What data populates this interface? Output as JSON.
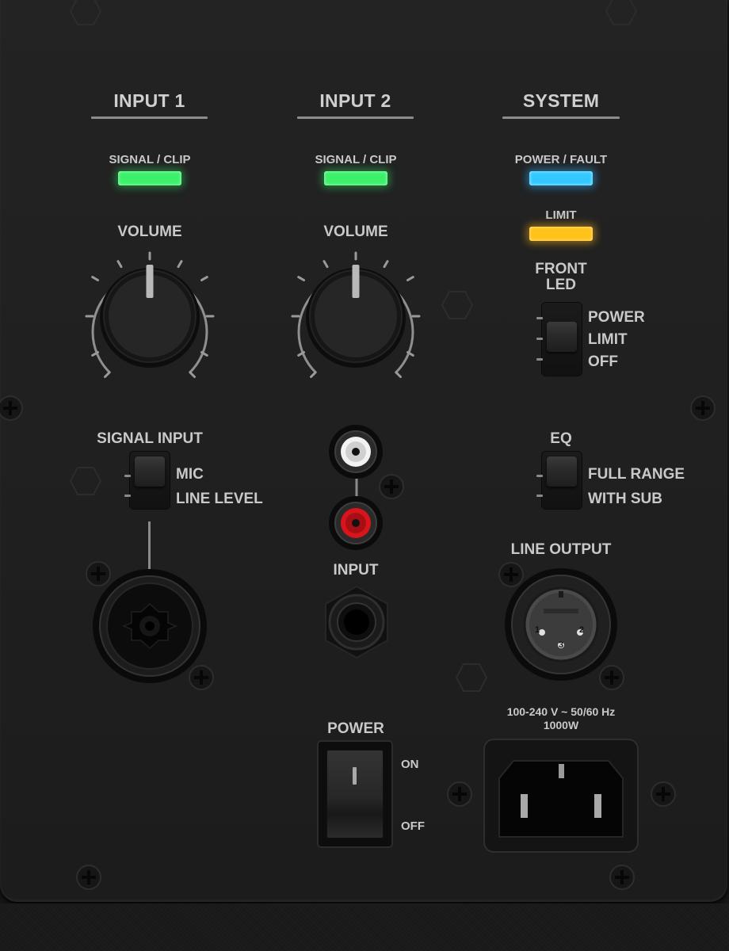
{
  "sections": {
    "input1": "INPUT 1",
    "input2": "INPUT 2",
    "system": "SYSTEM"
  },
  "indicators": {
    "signal_clip": "SIGNAL / CLIP",
    "power_fault": "POWER / FAULT",
    "limit": "LIMIT"
  },
  "volume_label": "VOLUME",
  "front_led": {
    "title_line1": "FRONT",
    "title_line2": "LED",
    "options": [
      "POWER",
      "LIMIT",
      "OFF"
    ]
  },
  "signal_input": {
    "title": "SIGNAL INPUT",
    "options": [
      "MIC",
      "LINE LEVEL"
    ]
  },
  "eq": {
    "title": "EQ",
    "options": [
      "FULL RANGE",
      "WITH SUB"
    ]
  },
  "input_jack_label": "INPUT",
  "line_output_label": "LINE OUTPUT",
  "xlr_pins": [
    "1",
    "3",
    "2"
  ],
  "power": {
    "title": "POWER",
    "on": "ON",
    "off": "OFF",
    "spec_line1": "100-240 V ~ 50/60 Hz",
    "spec_line2": "1000W"
  },
  "colors": {
    "signal_led": "#3cf06a",
    "power_fault_led": "#33c8ff",
    "limit_led": "#ffc21a",
    "rca_top": "#f2f2f2",
    "rca_bottom": "#d8141c"
  }
}
